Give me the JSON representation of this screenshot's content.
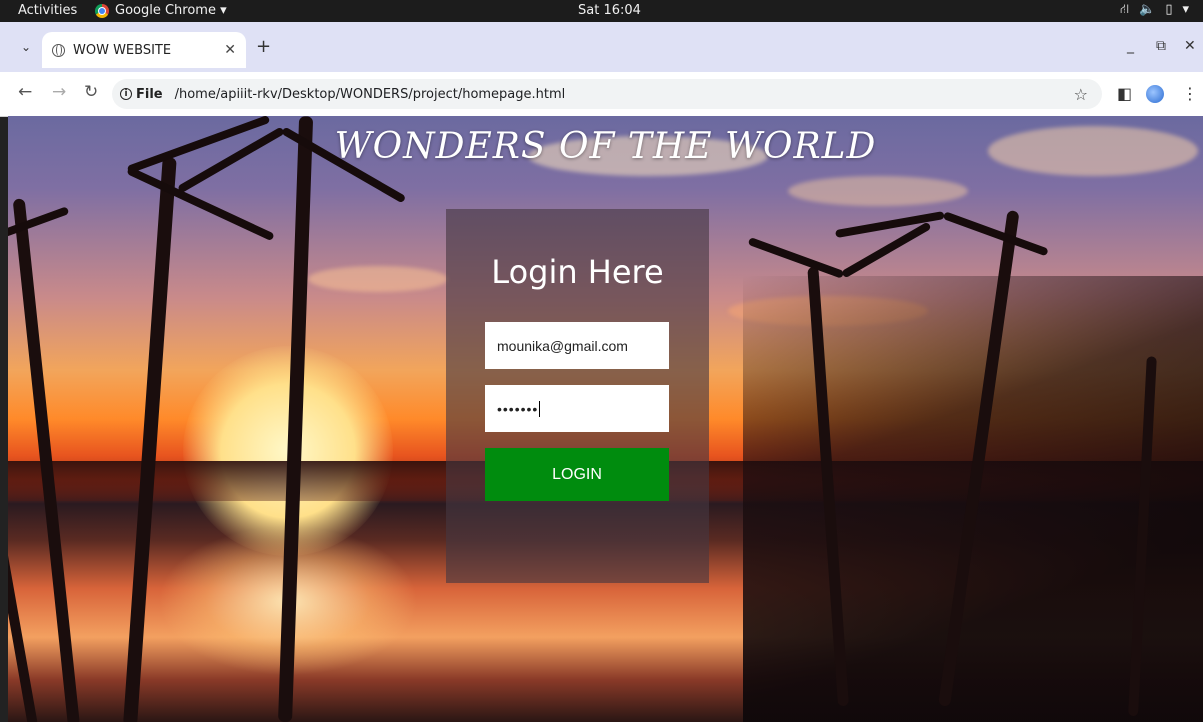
{
  "system_bar": {
    "activities": "Activities",
    "app_name": "Google Chrome ▾",
    "clock": "Sat 16:04",
    "tray_icons": [
      "network-icon",
      "volume-icon",
      "battery-icon",
      "system-menu-icon"
    ]
  },
  "browser": {
    "tab_title": "WOW WEBSITE",
    "url_scheme_label": "File",
    "url": "/home/apiiit-rkv/Desktop/WONDERS/project/homepage.html"
  },
  "page": {
    "site_title": "WONDERS OF THE WORLD",
    "login_title": "Login Here",
    "email_value": "mounika@gmail.com",
    "password_mask": "•••••••",
    "login_button": "LOGIN",
    "button_color": "#008c0e"
  }
}
